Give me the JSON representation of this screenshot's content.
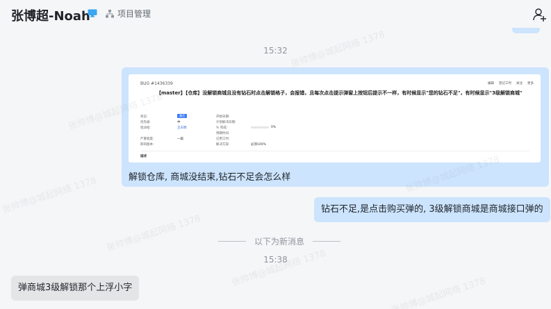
{
  "header": {
    "title": "张博超-Noah",
    "department": "项目管理"
  },
  "messages": {
    "time1": "15:32",
    "image_msg": {
      "bug_id": "BUG #1436339",
      "actions": [
        "编辑",
        "登记工时",
        "关注",
        "更多"
      ],
      "bug_title": "【master】【仓库】没解锁商城且没有钻石时点击解锁格子，会报错，且每次点击提示弹窗上按钮后提示不一样，有时候显示\"您的钻石不足\"，有时候显示\"3级解锁商城\"",
      "fields": {
        "status_label": "状态:",
        "status_value": "激活",
        "priority_label": "优先级:",
        "priority_value": "中",
        "assignee_label": "指派给:",
        "assignee_value": "王东明",
        "severity_label": "严重程度:",
        "severity_value": "一般",
        "version_label": "影响版本:",
        "start_label": "开始日期:",
        "deadline_label": "计划解决日期:",
        "progress_label": "% 完成:",
        "progress_value": "0%",
        "estimate_label": "预期时间:",
        "spent_label": "已用工时:",
        "done_label": "解决方案:",
        "done_value": "必须100%"
      },
      "desc_label": "描述",
      "caption": "解锁仓库, 商城没结束,钻石不足会怎么样"
    },
    "reply_mine": "钻石不足,是点击购买弹的, 3级解锁商城是商城接口弹的",
    "new_divider": "以下为新消息",
    "time2": "15:38",
    "reply_theirs": "弹商城3级解锁那个上浮小字"
  },
  "watermark": "张帅博@城起网络 1378"
}
